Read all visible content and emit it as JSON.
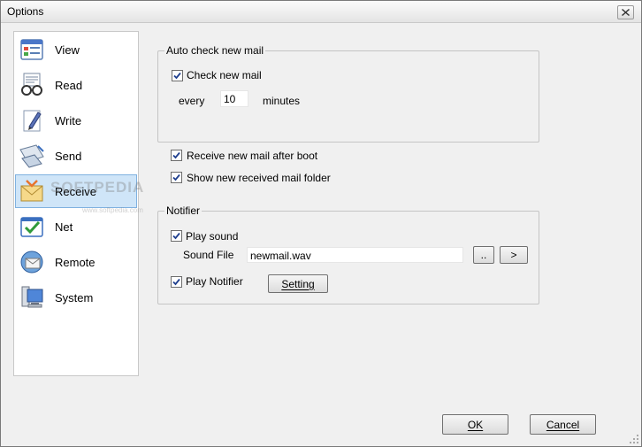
{
  "window": {
    "title": "Options"
  },
  "sidebar": {
    "items": [
      {
        "label": "View",
        "icon": "view-icon"
      },
      {
        "label": "Read",
        "icon": "read-glasses-icon"
      },
      {
        "label": "Write",
        "icon": "write-pen-icon"
      },
      {
        "label": "Send",
        "icon": "send-icon"
      },
      {
        "label": "Receive",
        "icon": "receive-envelope-icon",
        "selected": true
      },
      {
        "label": "Net",
        "icon": "net-check-icon"
      },
      {
        "label": "Remote",
        "icon": "remote-globe-mail-icon"
      },
      {
        "label": "System",
        "icon": "system-computer-icon"
      }
    ]
  },
  "auto_check": {
    "legend": "Auto check new mail",
    "check_label": "Check new mail",
    "check_checked": true,
    "every_label": "every",
    "minutes_value": "10",
    "minutes_label": "minutes"
  },
  "options": {
    "receive_after_boot_label": "Receive new mail after boot",
    "receive_after_boot_checked": true,
    "show_folder_label": "Show new received mail folder",
    "show_folder_checked": true
  },
  "notifier": {
    "legend": "Notifier",
    "play_sound_label": "Play sound",
    "play_sound_checked": true,
    "sound_file_label": "Sound File",
    "sound_file_value": "newmail.wav",
    "browse_label": "..",
    "play_button_label": ">",
    "play_notifier_label": "Play Notifier",
    "play_notifier_checked": true,
    "setting_label": "Setting"
  },
  "footer": {
    "ok_label": "OK",
    "cancel_label": "Cancel"
  },
  "watermark": {
    "text": "SOFTPEDIA",
    "subtext": "www.softpedia.com"
  },
  "colors": {
    "accent": "#3c7fb1",
    "selection": "#cfe5f8",
    "check": "#1f3f8f"
  }
}
